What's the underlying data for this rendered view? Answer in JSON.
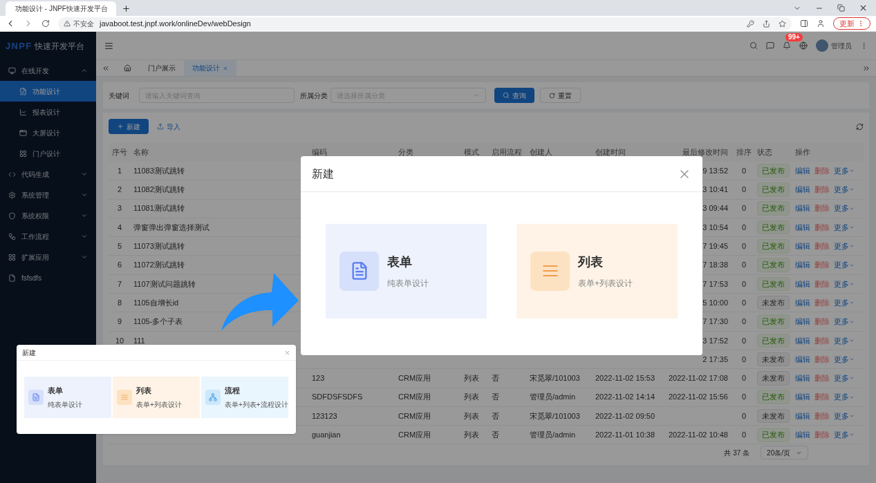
{
  "browser": {
    "tab_title": "功能设计 - JNPF快速开发平台",
    "security": "不安全",
    "url": "javaboot.test.jnpf.work/onlineDev/webDesign",
    "update_button": "更新"
  },
  "logo": {
    "brand": "JNPF",
    "suffix": "快速开发平台"
  },
  "sidebar": [
    {
      "label": "在线开发",
      "expanded": true,
      "children": [
        {
          "label": "功能设计",
          "selected": true
        },
        {
          "label": "报表设计",
          "selected": false
        },
        {
          "label": "大屏设计",
          "selected": false
        },
        {
          "label": "门户设计",
          "selected": false
        }
      ]
    },
    {
      "label": "代码生成",
      "expanded": false
    },
    {
      "label": "系统管理",
      "expanded": false
    },
    {
      "label": "系统权限",
      "expanded": false
    },
    {
      "label": "工作流程",
      "expanded": false
    },
    {
      "label": "扩展应用",
      "expanded": false
    },
    {
      "label": "fsfsdfs"
    }
  ],
  "header": {
    "notification_badge": "99+",
    "user": "管理员"
  },
  "tabs": [
    {
      "label": "门户展示",
      "selected": false
    },
    {
      "label": "功能设计",
      "selected": true
    }
  ],
  "search": {
    "fields": [
      {
        "label": "关键词",
        "placeholder": "请输入关键词查询",
        "kind": "input"
      },
      {
        "label": "所属分类",
        "placeholder": "请选择所属分类",
        "kind": "select"
      }
    ],
    "query_button": "查询",
    "reset_button": "重置"
  },
  "toolbar": {
    "new_button": "新建",
    "import_button": "导入"
  },
  "table": {
    "columns": [
      "序号",
      "名称",
      "编码",
      "分类",
      "模式",
      "启用流程",
      "创建人",
      "创建时间",
      "最后修改时间",
      "排序",
      "状态",
      "操作"
    ],
    "rows": [
      {
        "seq": "1",
        "name": "11083测试跳转",
        "modified": "9 13:52",
        "sort": "0",
        "status": {
          "label": "已发布",
          "published": true
        },
        "actions": [
          "编辑",
          "删除",
          "更多"
        ]
      },
      {
        "seq": "2",
        "name": "11082测试跳转",
        "modified": "3 10:41",
        "sort": "0",
        "status": {
          "label": "已发布",
          "published": true
        },
        "actions": [
          "编辑",
          "删除",
          "更多"
        ]
      },
      {
        "seq": "3",
        "name": "11081测试跳转",
        "modified": "3 09:44",
        "sort": "0",
        "status": {
          "label": "已发布",
          "published": true
        },
        "actions": [
          "编辑",
          "删除",
          "更多"
        ]
      },
      {
        "seq": "4",
        "name": "弹窗弹出弹窗选择测试",
        "modified": "3 10:54",
        "sort": "0",
        "status": {
          "label": "已发布",
          "published": true
        },
        "actions": [
          "编辑",
          "删除",
          "更多"
        ]
      },
      {
        "seq": "5",
        "name": "11073测试跳转",
        "modified": "7 19:45",
        "sort": "0",
        "status": {
          "label": "已发布",
          "published": true
        },
        "actions": [
          "编辑",
          "删除",
          "更多"
        ]
      },
      {
        "seq": "6",
        "name": "11072测试跳转",
        "modified": "7 18:38",
        "sort": "0",
        "status": {
          "label": "已发布",
          "published": true
        },
        "actions": [
          "编辑",
          "删除",
          "更多"
        ]
      },
      {
        "seq": "7",
        "name": "1107测试问题跳转",
        "modified": "7 17:53",
        "sort": "0",
        "status": {
          "label": "已发布",
          "published": true
        },
        "actions": [
          "编辑",
          "删除",
          "更多"
        ]
      },
      {
        "seq": "8",
        "name": "1105自增长id",
        "modified": "5 10:00",
        "sort": "0",
        "status": {
          "label": "未发布",
          "published": false
        },
        "actions": [
          "编辑",
          "删除",
          "更多"
        ]
      },
      {
        "seq": "9",
        "name": "1105-多个子表",
        "modified": "7 17:30",
        "sort": "0",
        "status": {
          "label": "已发布",
          "published": true
        },
        "actions": [
          "编辑",
          "删除",
          "更多"
        ]
      },
      {
        "seq": "10",
        "name": "111",
        "modified": "3 17:52",
        "sort": "0",
        "status": {
          "label": "已发布",
          "published": true
        },
        "actions": [
          "编辑",
          "删除",
          "更多"
        ]
      },
      {
        "modified": "2 17:35",
        "sort": "0",
        "status": {
          "label": "未发布",
          "published": false
        },
        "actions": [
          "编辑",
          "删除",
          "更多"
        ]
      },
      {
        "code": "123",
        "category": "CRM应用",
        "mode": "列表",
        "flow": "否",
        "creator": "宋觅翠/101003",
        "created": "2022-11-02 15:53",
        "modified": "2022-11-02 17:08",
        "sort": "0",
        "status": {
          "label": "未发布",
          "published": false
        },
        "actions": [
          "编辑",
          "删除",
          "更多"
        ]
      },
      {
        "code": "SDFDSFSDFS",
        "category": "CRM应用",
        "mode": "列表",
        "flow": "否",
        "creator": "管理员/admin",
        "created": "2022-11-02 14:14",
        "modified": "2022-11-02 15:56",
        "sort": "0",
        "status": {
          "label": "已发布",
          "published": true
        },
        "actions": [
          "编辑",
          "删除",
          "更多"
        ]
      },
      {
        "code": "123123",
        "category": "CRM应用",
        "mode": "列表",
        "flow": "否",
        "creator": "宋觅翠/101003",
        "created": "2022-11-02 09:50",
        "sort": "0",
        "status": {
          "label": "未发布",
          "published": false
        },
        "actions": [
          "编辑",
          "删除",
          "更多"
        ]
      },
      {
        "code": "guanjian",
        "category": "CRM应用",
        "mode": "列表",
        "flow": "否",
        "creator": "管理员/admin",
        "created": "2022-11-01 10:38",
        "modified": "2022-11-02 10:48",
        "sort": "0",
        "status": {
          "label": "已发布",
          "published": true
        },
        "actions": [
          "编辑",
          "删除",
          "更多"
        ]
      }
    ]
  },
  "pagination": {
    "total": "共 37 条",
    "page_size": "20条/页"
  },
  "dialog": {
    "title": "新建",
    "options": [
      {
        "kind": "form",
        "title": "表单",
        "subtitle": "纯表单设计"
      },
      {
        "kind": "list",
        "title": "列表",
        "subtitle": "表单+列表设计"
      }
    ]
  },
  "inset_dialog": {
    "title": "新建",
    "options": [
      {
        "kind": "form",
        "title": "表单",
        "subtitle": "纯表单设计"
      },
      {
        "kind": "list",
        "title": "列表",
        "subtitle": "表单+列表设计"
      },
      {
        "kind": "flow",
        "title": "流程",
        "subtitle": "表单+列表+流程设计"
      }
    ]
  }
}
